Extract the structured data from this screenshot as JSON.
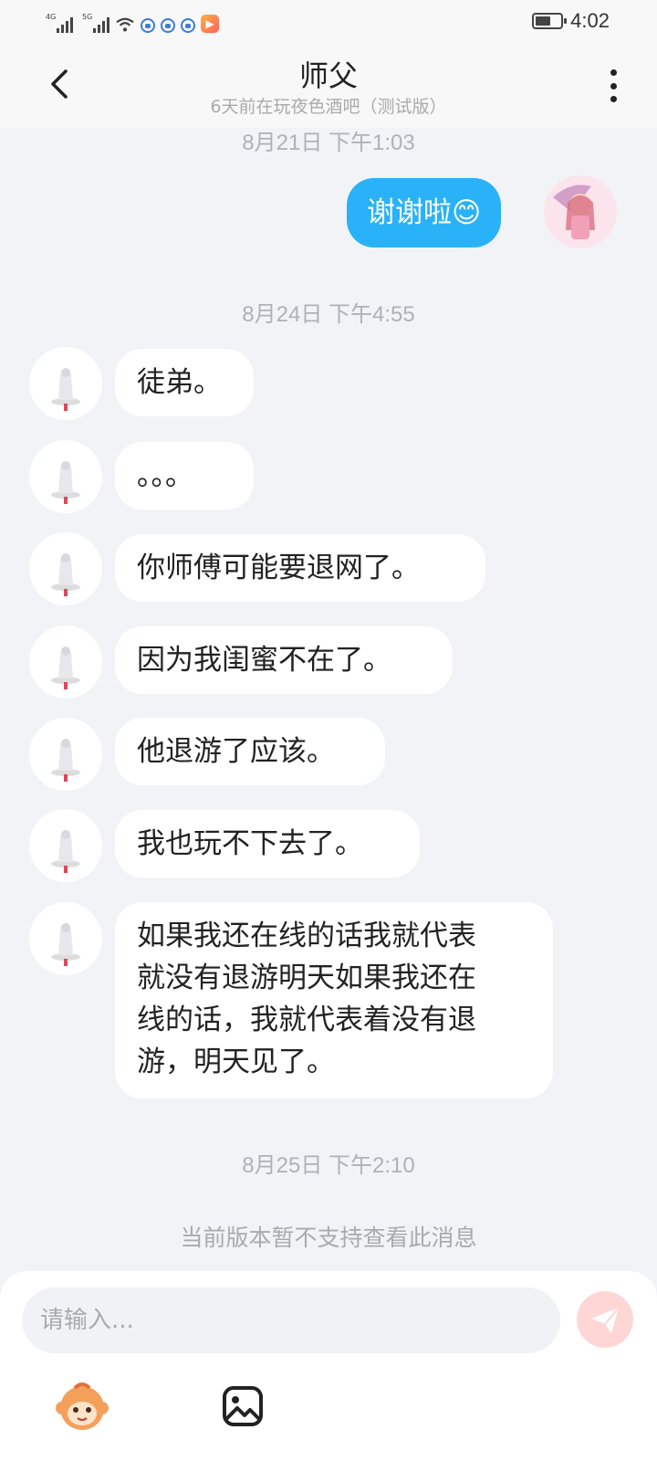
{
  "status_bar": {
    "time": "4:02",
    "network_1": "4G",
    "network_2": "5G",
    "app_icon": "play-app-icon"
  },
  "header": {
    "title": "师父",
    "subtitle": "6天前在玩夜色酒吧（测试版）",
    "back_icon": "chevron-left-icon",
    "more_icon": "more-vertical-icon"
  },
  "timestamps": {
    "t1": "8月21日 下午1:03",
    "t2": "8月24日 下午4:55",
    "t3": "8月25日 下午2:10"
  },
  "messages": {
    "self_1": "谢谢啦😊",
    "m1": "徒弟。",
    "m2": "。。。",
    "m3": "你师傅可能要退网了。",
    "m4": "因为我闺蜜不在了。",
    "m5": "他退游了应该。",
    "m6": "我也玩不下去了。",
    "m7": "如果我还在线的话我就代表\n就没有退游明天如果我还在\n线的话，我就代表着没有退\n游，明天见了。"
  },
  "notice": "当前版本暂不支持查看此消息",
  "input": {
    "placeholder": "请输入...",
    "send_icon": "send-icon",
    "emoji_icon": "monkey-sticker-icon",
    "image_icon": "image-icon"
  },
  "colors": {
    "self_bubble": "#29b2f8",
    "other_bubble": "#ffffff",
    "background": "#f2f3f6",
    "send_button": "#ffd6d6"
  }
}
